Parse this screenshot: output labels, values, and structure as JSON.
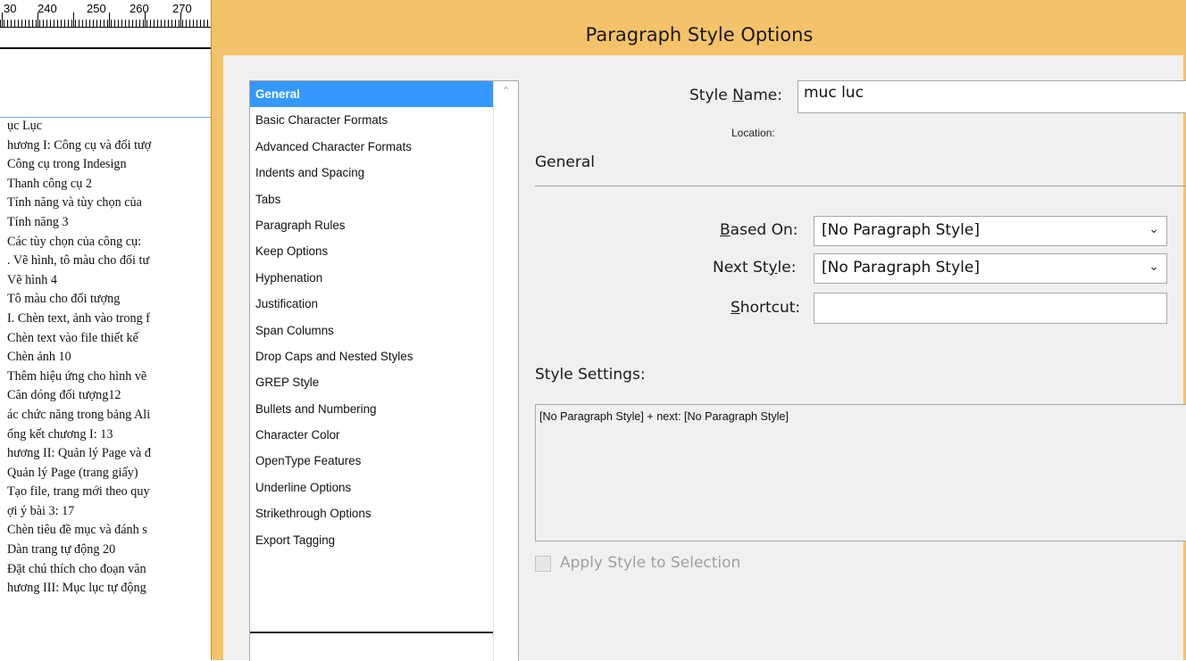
{
  "ruler": {
    "numbers": [
      "30",
      "240",
      "250",
      "260",
      "270"
    ]
  },
  "document": {
    "lines": [
      "ục Lục",
      "hương I: Công cụ và đối tượ",
      " Công cụ trong Indesign",
      "  Thanh công cụ      2",
      "  Tính năng và tùy chọn của",
      "  Tính năng   3",
      "  Các tùy chọn của công cụ:",
      ". Vẽ hình, tô màu cho đối tư",
      "  Vẽ hình       4",
      "  Tô màu cho đối tượng",
      "I. Chèn text, ảnh vào trong f",
      "  Chèn text vào file thiết kế",
      "  Chèn ảnh    10",
      "  Thêm hiệu ứng cho hình vẽ",
      "  Căn dóng đối tượng12",
      "ác chức năng trong bảng Ali",
      "ổng kết chương I:    13",
      "hương II: Quản lý Page và đ",
      " Quản lý Page (trang giấy)",
      "  Tạo file, trang mới theo quy",
      "ợi ý bài 3:    17",
      "  Chèn tiêu đề mục và đánh s",
      "  Dàn trang tự động   20",
      "  Đặt chú thích cho đoạn văn",
      "hương III: Mục lục tự động"
    ]
  },
  "dialog": {
    "title": "Paragraph Style Options",
    "categories": [
      "General",
      "Basic Character Formats",
      "Advanced Character Formats",
      "Indents and Spacing",
      "Tabs",
      "Paragraph Rules",
      "Keep Options",
      "Hyphenation",
      "Justification",
      "Span Columns",
      "Drop Caps and Nested Styles",
      "GREP Style",
      "Bullets and Numbering",
      "Character Color",
      "OpenType Features",
      "Underline Options",
      "Strikethrough Options",
      "Export Tagging"
    ],
    "selected_category": "General",
    "style_name_label_pre": "Style ",
    "style_name_label_ul": "N",
    "style_name_label_post": "ame:",
    "style_name_value": "muc luc",
    "location_label": "Location:",
    "section_title": "General",
    "based_on_label_ul": "B",
    "based_on_label_post": "ased On:",
    "based_on_value": "[No Paragraph Style]",
    "next_style_label_pre": "Next St",
    "next_style_label_ul": "y",
    "next_style_label_post": "le:",
    "next_style_value": "[No Paragraph Style]",
    "shortcut_label_ul": "S",
    "shortcut_label_post": "hortcut:",
    "shortcut_value": "",
    "style_settings_label": "Style Settings:",
    "style_settings_text": "[No Paragraph Style] + next: [No Paragraph Style]",
    "apply_label": "Apply Style to Selection",
    "apply_checked": false
  }
}
